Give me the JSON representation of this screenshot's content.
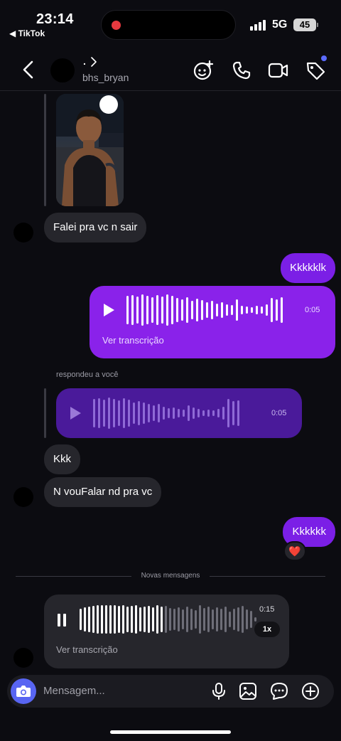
{
  "status_bar": {
    "time": "23:14",
    "back_app": "◀ TikTok",
    "network": "5G",
    "battery": "45"
  },
  "header": {
    "display_name": ".",
    "username": "bhs_bryan"
  },
  "messages": {
    "incoming_1": "Falei pra vc n sair",
    "outgoing_1": "Kkkkklk",
    "audio_out_duration": "0:05",
    "audio_out_transcript_link": "Ver transcrição",
    "replied_label": "respondeu a você",
    "audio_reply_duration": "0:05",
    "incoming_2": "Kkk",
    "incoming_3": "N vouFalar nd pra vc",
    "outgoing_2": "Kkkkkk",
    "reaction": "❤️"
  },
  "divider": {
    "label": "Novas mensagens"
  },
  "audio_in": {
    "duration": "0:15",
    "speed": "1x",
    "transcript_link": "Ver transcrição"
  },
  "composer": {
    "placeholder": "Mensagem..."
  },
  "colors": {
    "accent": "#7b1fe6",
    "camera": "#5865f2",
    "background": "#0c0c11",
    "bubble_in": "#26262c"
  }
}
